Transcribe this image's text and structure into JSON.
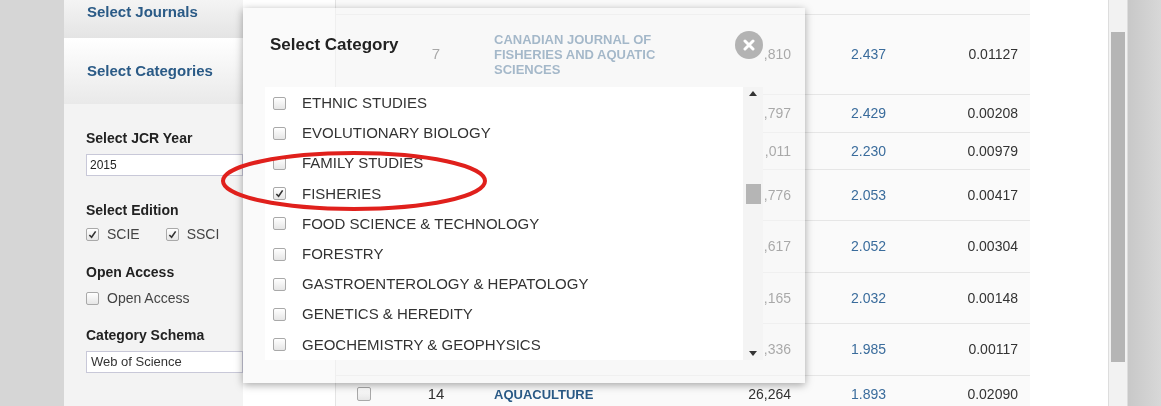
{
  "sidebar": {
    "journals_header": "Select Journals",
    "categories_header": "Select Categories",
    "year": {
      "label": "Select JCR Year",
      "value": "2015"
    },
    "edition": {
      "label": "Select Edition",
      "options": [
        {
          "label": "SCIE",
          "checked": true
        },
        {
          "label": "SSCI",
          "checked": true
        }
      ]
    },
    "open_access": {
      "label": "Open Access",
      "option": {
        "label": "Open Access",
        "checked": false
      }
    },
    "schema": {
      "label": "Category Schema",
      "value": "Web of Science"
    }
  },
  "table": {
    "rows": [
      {
        "rank": "7",
        "title": "CANADIAN JOURNAL OF FISHERIES AND AQUATIC SCIENCES",
        "total_cites": ",810",
        "jif": "2.437",
        "eigenfactor": "0.01127"
      },
      {
        "total_cites": ",797",
        "jif": "2.429",
        "eigenfactor": "0.00208"
      },
      {
        "total_cites": ",011",
        "jif": "2.230",
        "eigenfactor": "0.00979"
      },
      {
        "total_cites": ",776",
        "jif": "2.053",
        "eigenfactor": "0.00417"
      },
      {
        "total_cites": ",617",
        "jif": "2.052",
        "eigenfactor": "0.00304"
      },
      {
        "total_cites": ",165",
        "jif": "2.032",
        "eigenfactor": "0.00148"
      },
      {
        "total_cites": ",336",
        "jif": "1.985",
        "eigenfactor": "0.00117"
      },
      {
        "checked": false,
        "rank": "14",
        "title": "AQUACULTURE",
        "total_cites": "26,264",
        "jif": "1.893",
        "eigenfactor": "0.02090"
      }
    ]
  },
  "dialog": {
    "title": "Select Category",
    "items": [
      {
        "label": "ETHNIC STUDIES",
        "checked": false
      },
      {
        "label": "EVOLUTIONARY BIOLOGY",
        "checked": false
      },
      {
        "label": "FAMILY STUDIES",
        "checked": false
      },
      {
        "label": "FISHERIES",
        "checked": true,
        "highlighted": true
      },
      {
        "label": "FOOD SCIENCE & TECHNOLOGY",
        "checked": false
      },
      {
        "label": "FORESTRY",
        "checked": false
      },
      {
        "label": "GASTROENTEROLOGY & HEPATOLOGY",
        "checked": false
      },
      {
        "label": "GENETICS & HEREDITY",
        "checked": false
      },
      {
        "label": "GEOCHEMISTRY & GEOPHYSICS",
        "checked": false
      }
    ]
  }
}
